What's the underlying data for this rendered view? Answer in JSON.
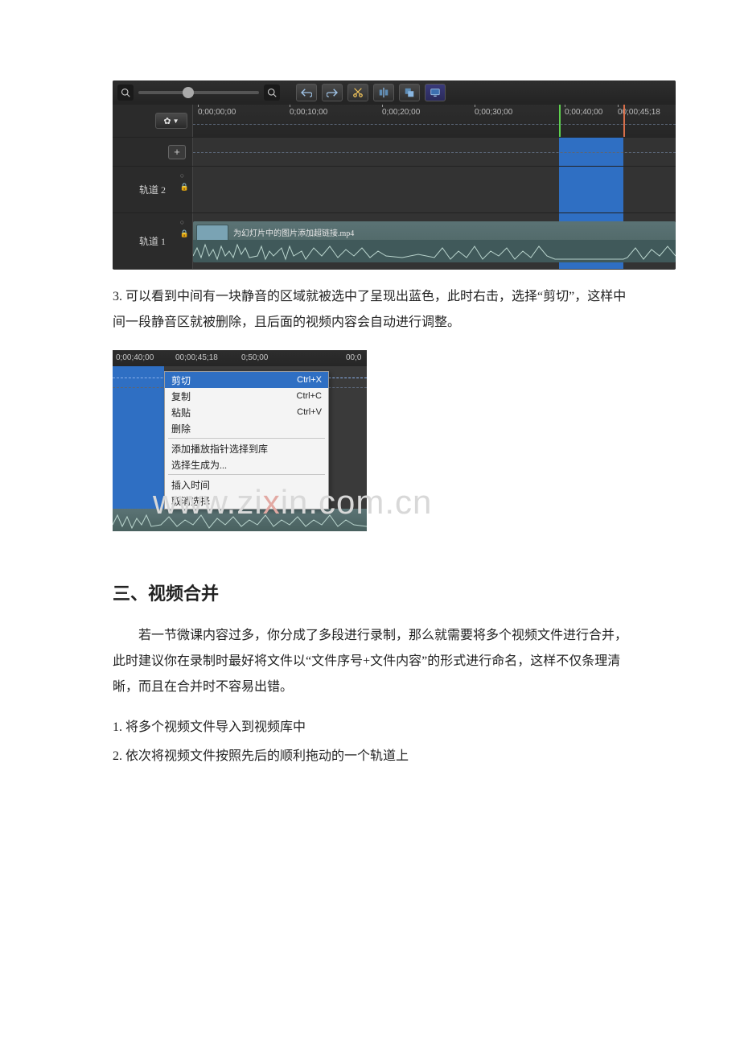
{
  "shot1": {
    "ruler_ticks": [
      "0;00;00;00",
      "0;00;10;00",
      "0;00;20;00",
      "0;00;30;00",
      "0;00;40;00",
      "00;00;45;18"
    ],
    "track2_label": "轨道 2",
    "track1_label": "轨道 1",
    "clip_title": "为幻灯片中的图片添加超链接.mp4"
  },
  "para_after_shot1": "3. 可以看到中间有一块静音的区域就被选中了呈现出蓝色，此时右击，选择“剪切”，这样中间一段静音区就被删除，且后面的视频内容会自动进行调整。",
  "shot2": {
    "ruler_ticks": [
      "0;00;40;00",
      "00;00;45;18",
      "0;50;00",
      "00;0"
    ],
    "menu": {
      "cut": "剪切",
      "cut_sc": "Ctrl+X",
      "copy": "复制",
      "copy_sc": "Ctrl+C",
      "paste": "粘贴",
      "paste_sc": "Ctrl+V",
      "delete": "删除",
      "add_marker": "添加播放指针选择到库",
      "gen_select": "选择生成为...",
      "insert_time": "插入时间",
      "cancel_sel": "取消选择"
    }
  },
  "watermark": "www.zixin.com.cn",
  "section_title": "三、视频合并",
  "para1": "　　若一节微课内容过多，你分成了多段进行录制，那么就需要将多个视频文件进行合并，此时建议你在录制时最好将文件以“文件序号+文件内容”的形式进行命名，这样不仅条理清晰，而且在合并时不容易出错。",
  "li1": "1. 将多个视频文件导入到视频库中",
  "li2": "2. 依次将视频文件按照先后的顺利拖动的一个轨道上"
}
